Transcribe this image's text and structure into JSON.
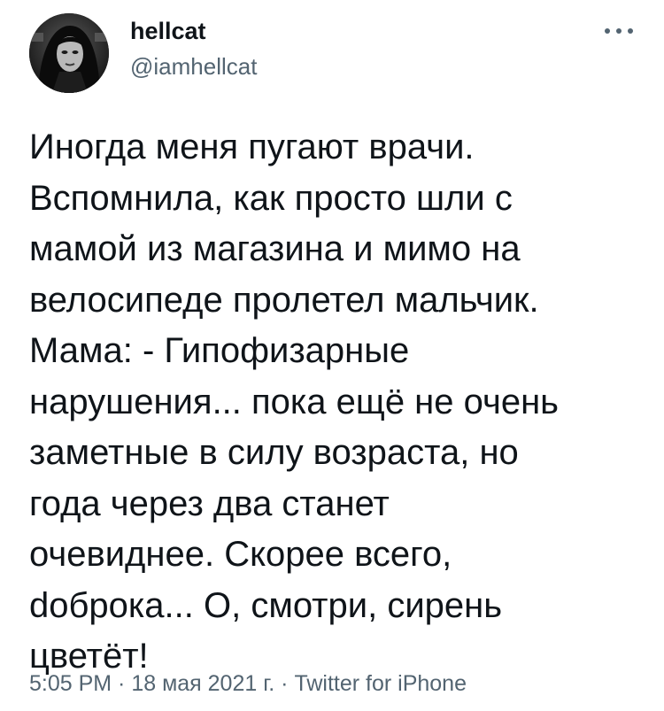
{
  "tweet": {
    "author": {
      "display_name": "hellcat",
      "handle": "@iamhellcat"
    },
    "more_icon": "more-horizontal-icon",
    "text": "Иногда меня пугают врачи.\nВспомнила, как просто шли с\nмамой из магазина и мимо на\nвелосипеде пролетел мальчик.\nМама: - Гипофизарные\nнарушения... пока ещё не очень\nзаметные в силу возраста, но\nгода через два станет\nочевиднее. Скорее всего,\ndоброка... О, смотри, сирень\nцветёт!",
    "meta": {
      "time": "5:05 PM",
      "date": "18 мая 2021 г.",
      "separator": " · ",
      "source": "Twitter for iPhone"
    }
  },
  "colors": {
    "text_primary": "#0f1419",
    "text_secondary": "#536471",
    "background": "#ffffff"
  }
}
